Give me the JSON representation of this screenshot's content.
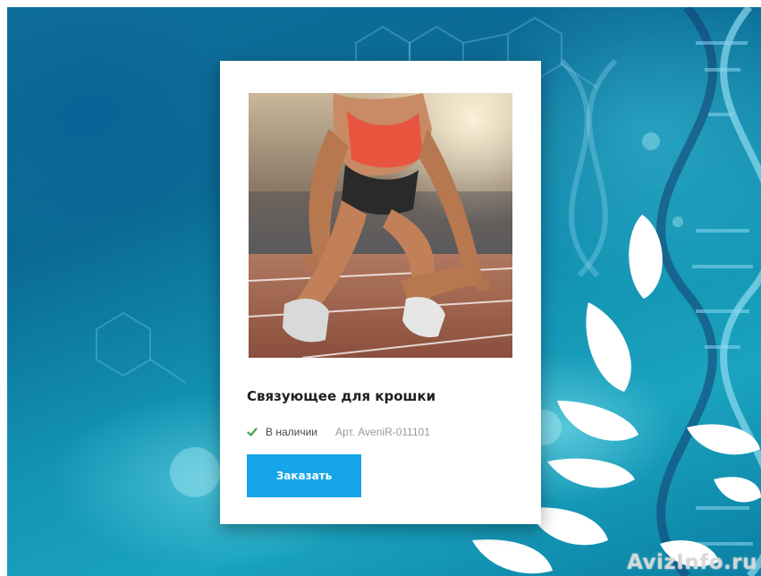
{
  "product": {
    "title": "Связующее для крошки",
    "availability": "В наличии",
    "sku": "Арт. AveniR-011101",
    "order_label": "Заказать",
    "image_subject": "sprinter-at-starting-line"
  },
  "watermark": "AvizInfo.ru",
  "colors": {
    "button": "#16a5e8",
    "check": "#3aa64a",
    "card": "#ffffff",
    "background": "#0f6f9c"
  },
  "icons": {
    "availability": "check-icon"
  }
}
